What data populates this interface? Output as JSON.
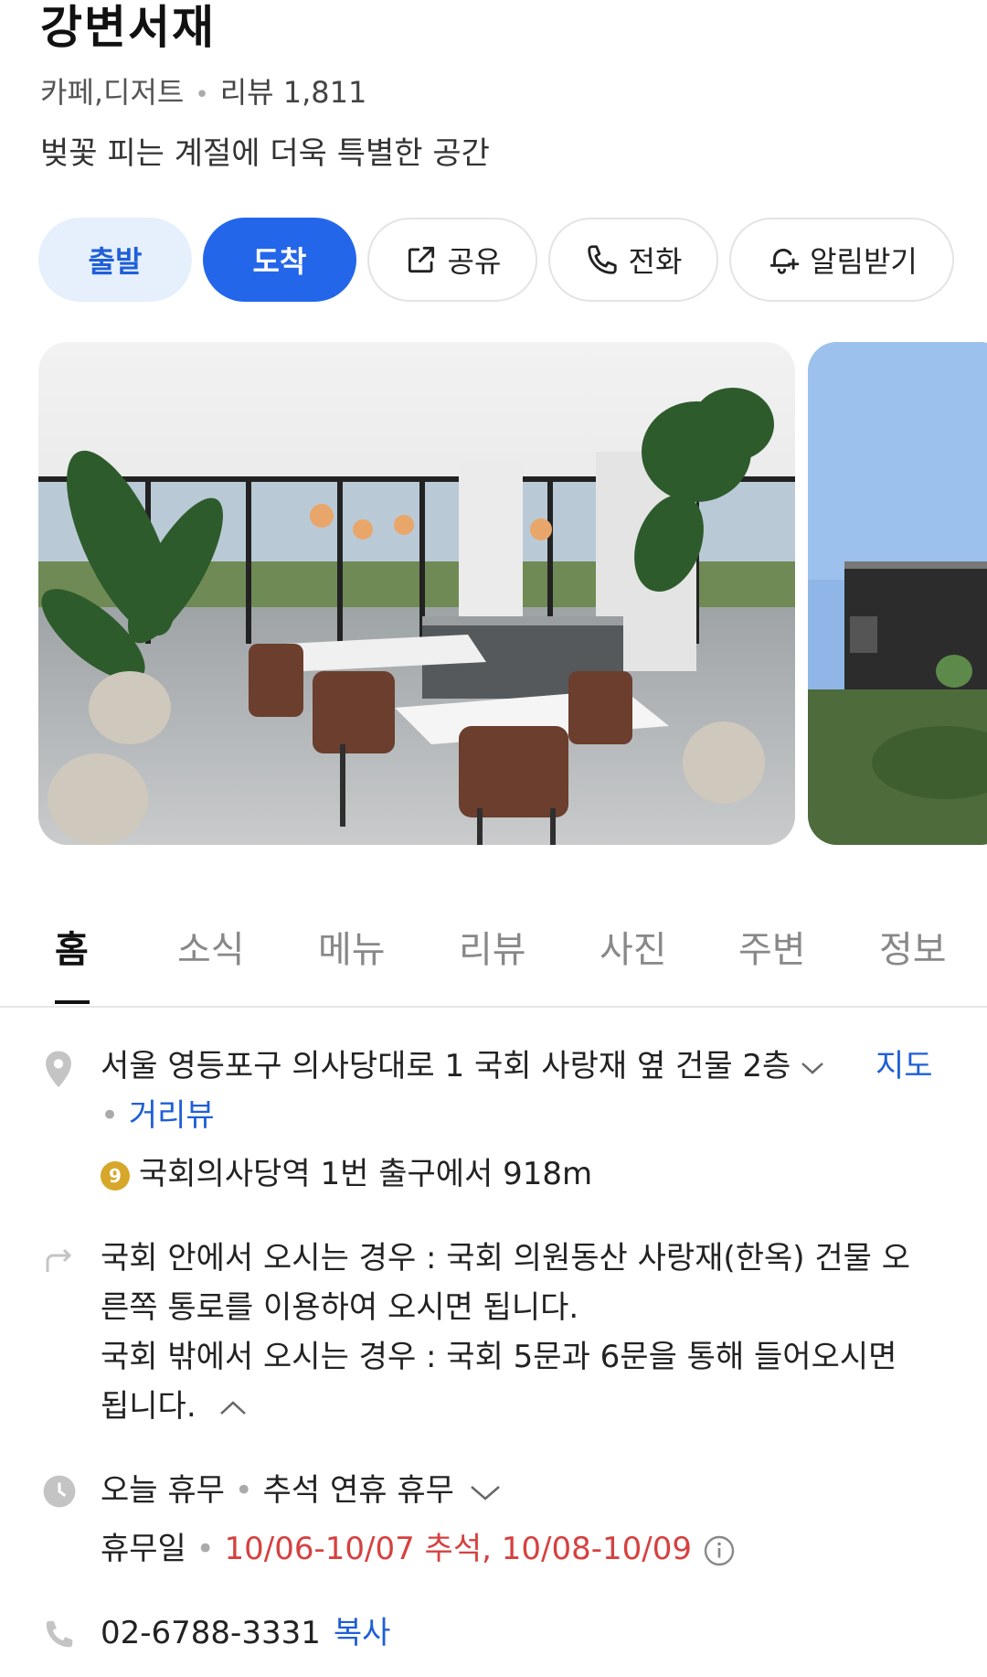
{
  "place": {
    "name": "강변서재",
    "category": "카페,디저트",
    "review_label": "리뷰 1,811",
    "description": "벚꽃 피는 계절에 더욱 특별한 공간"
  },
  "actions": {
    "depart": "출발",
    "arrive": "도착",
    "share": "공유",
    "call": "전화",
    "alarm": "알림받기"
  },
  "tabs": [
    "홈",
    "소식",
    "메뉴",
    "리뷰",
    "사진",
    "주변",
    "정보"
  ],
  "info": {
    "address": "서울 영등포구 의사당대로 1 국회 사랑재 옆 건물 2층",
    "map_link": "지도",
    "street_view_link": "거리뷰",
    "subway_line": "9",
    "subway_text": "국회의사당역 1번 출구에서 918m",
    "directions_line1": "국회 안에서 오시는 경우 : 국회 의원동산 사랑재(한옥) 건물 오",
    "directions_line2": "른쪽 통로를 이용하여 오시면 됩니다.",
    "directions_line3": "국회 밖에서 오시는 경우 : 국회 5문과 6문을 통해 들어오시면",
    "directions_line4": "됩니다.",
    "hours_status": "오늘 휴무",
    "hours_note": "추석 연휴 휴무",
    "holiday_label": "휴무일",
    "holiday_dates": "10/06-10/07 추석, 10/08-10/09",
    "phone": "02-6788-3331",
    "copy_label": "복사"
  },
  "colors": {
    "accent": "#2466ea",
    "accent_light": "#e6effc",
    "holiday_red": "#d6413f",
    "subway_line9": "#d6a72a"
  }
}
